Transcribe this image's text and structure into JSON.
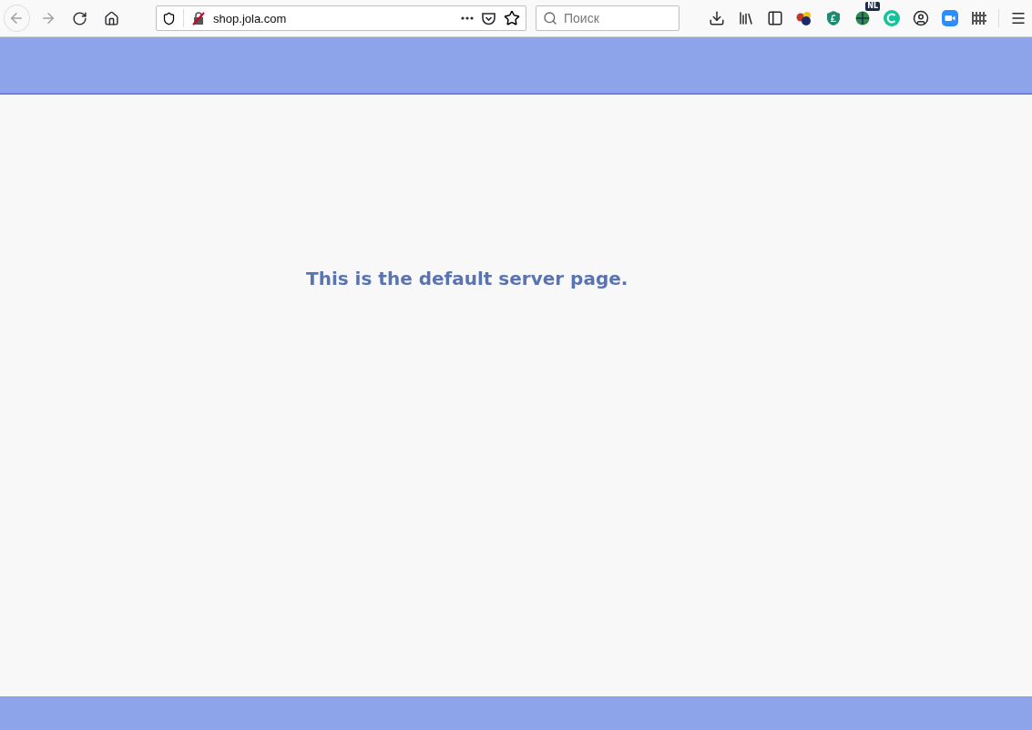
{
  "browser": {
    "back_disabled": true,
    "forward_disabled": true,
    "url": "shop.jola.com",
    "search": {
      "placeholder": "Поиск"
    },
    "extension_badge": "NL"
  },
  "page": {
    "message": "This is the default server page."
  }
}
